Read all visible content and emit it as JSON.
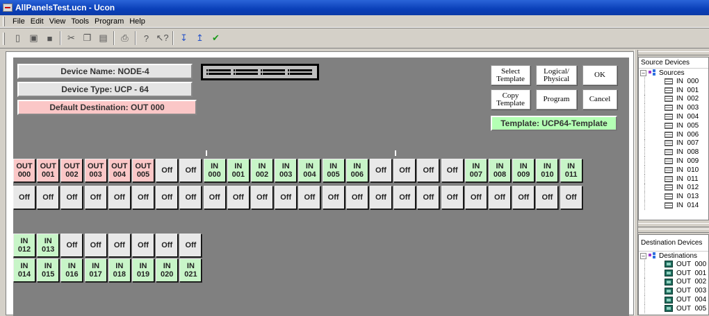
{
  "window": {
    "title": "AllPanelsTest.ucn - Ucon"
  },
  "menu": [
    "File",
    "Edit",
    "View",
    "Tools",
    "Program",
    "Help"
  ],
  "toolbar": [
    {
      "name": "new-file-icon",
      "glyph": "▯"
    },
    {
      "name": "open-folder-icon",
      "glyph": "▣"
    },
    {
      "name": "save-icon",
      "glyph": "■"
    },
    {
      "sep": true
    },
    {
      "name": "cut-icon",
      "glyph": "✂"
    },
    {
      "name": "copy-icon",
      "glyph": "❐"
    },
    {
      "name": "paste-icon",
      "glyph": "▤"
    },
    {
      "sep": true
    },
    {
      "name": "print-icon",
      "glyph": "⎙"
    },
    {
      "sep": true
    },
    {
      "name": "help-icon",
      "glyph": "?"
    },
    {
      "name": "context-help-icon",
      "glyph": "↖?"
    },
    {
      "sep": true
    },
    {
      "name": "download-icon",
      "glyph": "↧"
    },
    {
      "name": "upload-icon",
      "glyph": "↥"
    },
    {
      "name": "checkmark-icon",
      "glyph": "✔"
    }
  ],
  "device": {
    "name": "Device Name: NODE-4",
    "type": "Device Type: UCP - 64",
    "default_destination": "Default Destination: OUT 000"
  },
  "buttons": {
    "select_template": "Select\nTemplate",
    "logical_physical": "Logical/\nPhysical",
    "ok": "OK",
    "copy_template": "Copy\nTemplate",
    "program": "Program",
    "cancel": "Cancel"
  },
  "template_label": "Template: UCP64-Template",
  "panel_rows": [
    {
      "top": [
        "OUT 000",
        "OUT 001",
        "OUT 002",
        "OUT 003",
        "OUT 004",
        "OUT 005",
        "Off",
        "Off",
        "IN 000",
        "IN 001",
        "IN 002",
        "IN 003",
        "IN 004",
        "IN 005",
        "IN 006",
        "Off",
        "Off",
        "Off",
        "Off",
        "IN 007",
        "IN 008",
        "IN 009",
        "IN 010",
        "IN 011"
      ],
      "bottom": [
        "Off",
        "Off",
        "Off",
        "Off",
        "Off",
        "Off",
        "Off",
        "Off",
        "Off",
        "Off",
        "Off",
        "Off",
        "Off",
        "Off",
        "Off",
        "Off",
        "Off",
        "Off",
        "Off",
        "Off",
        "Off",
        "Off",
        "Off",
        "Off"
      ]
    },
    {
      "top": [
        "IN 012",
        "IN 013",
        "Off",
        "Off",
        "Off",
        "Off",
        "Off",
        "Off"
      ],
      "bottom": [
        "IN 014",
        "IN 015",
        "IN 016",
        "IN 017",
        "IN 018",
        "IN 019",
        "IN 020",
        "IN 021"
      ]
    }
  ],
  "source_devices": {
    "title": "Source Devices",
    "root": "Sources",
    "items": [
      "IN  000",
      "IN  001",
      "IN  002",
      "IN  003",
      "IN  004",
      "IN  005",
      "IN  006",
      "IN  007",
      "IN  008",
      "IN  009",
      "IN  010",
      "IN  011",
      "IN  012",
      "IN  013",
      "IN  014"
    ]
  },
  "destination_devices": {
    "title": "Destination Devices",
    "root": "Destinations",
    "items": [
      "OUT  000",
      "OUT  001",
      "OUT  002",
      "OUT  003",
      "OUT  004",
      "OUT  005"
    ]
  }
}
